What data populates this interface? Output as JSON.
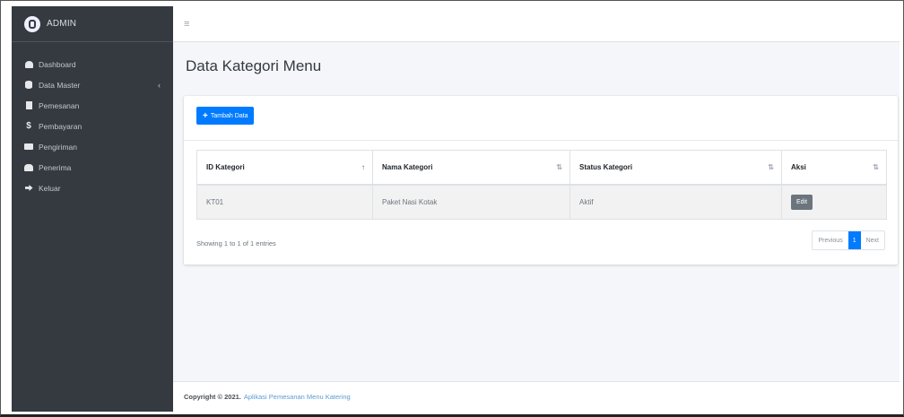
{
  "brand": {
    "name": "ADMIN"
  },
  "sidebar": {
    "items": [
      {
        "label": "Dashboard",
        "icon": "dashboard-icon"
      },
      {
        "label": "Data Master",
        "icon": "database-icon",
        "chevron": "‹"
      },
      {
        "label": "Pemesanan",
        "icon": "document-icon"
      },
      {
        "label": "Pembayaran",
        "icon": "dollar-icon"
      },
      {
        "label": "Pengiriman",
        "icon": "truck-icon"
      },
      {
        "label": "Penerima",
        "icon": "users-icon"
      },
      {
        "label": "Keluar",
        "icon": "sign-out-icon"
      }
    ]
  },
  "topbar": {
    "menu_icon": "≡"
  },
  "page": {
    "title": "Data Kategori Menu"
  },
  "toolbar": {
    "add_label": "Tambah Data"
  },
  "table": {
    "columns": [
      "ID Kategori",
      "Nama Kategori",
      "Status Kategori",
      "Aksi"
    ],
    "rows": [
      {
        "id": "KT01",
        "name": "Paket Nasi Kotak",
        "status": "Aktif",
        "action": "Edit"
      }
    ]
  },
  "pagination": {
    "info": "Showing 1 to 1 of 1 entries",
    "previous": "Previous",
    "current": "1",
    "next": "Next"
  },
  "footer": {
    "copyright": "Copyright © 2021.",
    "app_name": "Aplikasi Pemesanan Menu Katering"
  },
  "colors": {
    "sidebar": "#343a40",
    "primary": "#007bff",
    "secondary": "#6c757d",
    "content_bg": "#f4f6f9"
  }
}
